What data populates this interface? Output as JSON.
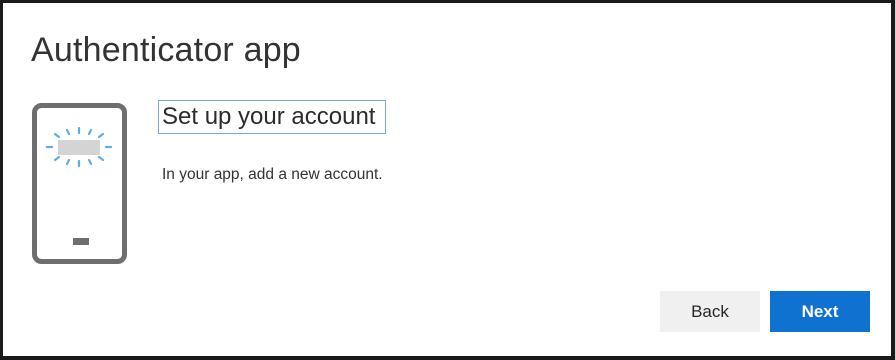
{
  "title": "Authenticator app",
  "step": {
    "heading": "Set up your account",
    "description": "In your app, add a new account."
  },
  "illustration": {
    "icon": "phone-add-account-icon",
    "colors": {
      "phone_outline": "#6e6e6e",
      "screen_bar": "#d4d4d4",
      "sparkle": "#5aaee6"
    }
  },
  "buttons": {
    "back_label": "Back",
    "next_label": "Next"
  },
  "colors": {
    "accent": "#0f72d1",
    "focus_outline": "#7aa7d8"
  }
}
